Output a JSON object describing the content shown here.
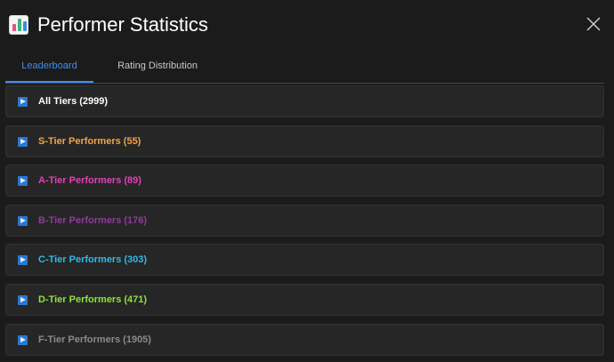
{
  "header": {
    "title": "Performer Statistics",
    "app_icon": "bar-chart-icon",
    "close_icon": "close-icon"
  },
  "tabs": [
    {
      "label": "Leaderboard",
      "active": true
    },
    {
      "label": "Rating Distribution",
      "active": false
    }
  ],
  "tiers": [
    {
      "label": "All Tiers (2999)",
      "color": "#ffffff"
    },
    {
      "label": "S-Tier Performers (55)",
      "color": "#f2a34a"
    },
    {
      "label": "A-Tier Performers (89)",
      "color": "#e63fb8"
    },
    {
      "label": "B-Tier Performers (176)",
      "color": "#8e3c9a"
    },
    {
      "label": "C-Tier Performers (303)",
      "color": "#31b8e8"
    },
    {
      "label": "D-Tier Performers (471)",
      "color": "#8ee23c"
    },
    {
      "label": "F-Tier Performers (1905)",
      "color": "#8a8a8a"
    }
  ],
  "colors": {
    "accent": "#3d8ef5",
    "background": "#1b1b1b",
    "row_background": "#262626"
  }
}
